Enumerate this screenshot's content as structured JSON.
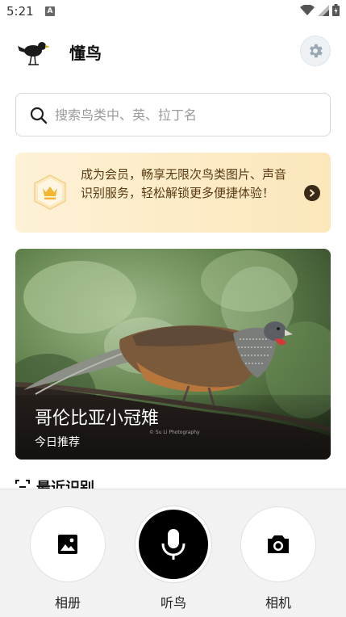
{
  "status_bar": {
    "time": "5:21",
    "notification_letter": "A"
  },
  "header": {
    "title": "懂鸟",
    "logo_icon": "blackbird-logo-icon",
    "settings_icon": "gear-icon"
  },
  "search": {
    "placeholder": "搜索鸟类中、英、拉丁名",
    "value": "",
    "icon": "search-icon"
  },
  "member_banner": {
    "text": "成为会员，畅享无限次鸟类图片、声音识别服务，轻松解锁更多便捷体验！",
    "icon": "crown-icon",
    "arrow_icon": "chevron-right-icon"
  },
  "featured": {
    "name": "哥伦比亚小冠雉",
    "subtitle": "今日推荐",
    "watermark": "© Su Li Photography"
  },
  "recent": {
    "title": "最近识别",
    "icon": "scan-icon"
  },
  "actions": [
    {
      "label": "相册",
      "icon": "image-icon"
    },
    {
      "label": "听鸟",
      "icon": "microphone-icon"
    },
    {
      "label": "相机",
      "icon": "camera-icon"
    }
  ],
  "colors": {
    "banner_start": "#fdf1d6",
    "banner_end": "#fce7bb",
    "banner_text": "#5a3a12",
    "bottom_panel": "#f2f2f2",
    "mic_button": "#000000"
  }
}
